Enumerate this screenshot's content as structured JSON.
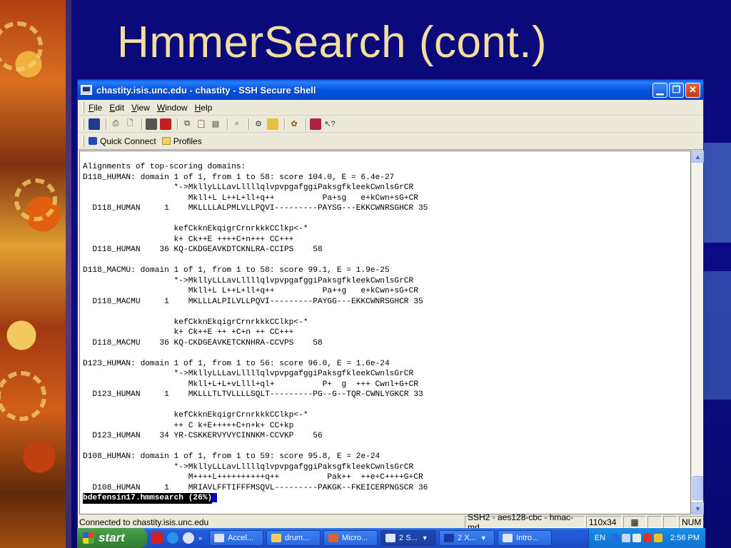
{
  "slide": {
    "title": "HmmerSearch (cont.)"
  },
  "window": {
    "title": "chastity.isis.unc.edu - chastity - SSH Secure Shell",
    "menu": [
      {
        "pre": "",
        "u": "F",
        "post": "ile"
      },
      {
        "pre": "",
        "u": "E",
        "post": "dit"
      },
      {
        "pre": "",
        "u": "V",
        "post": "iew"
      },
      {
        "pre": "",
        "u": "W",
        "post": "indow"
      },
      {
        "pre": "",
        "u": "H",
        "post": "elp"
      }
    ],
    "toolbar_icons": [
      "save-icon",
      "print-icon",
      "print-preview-icon",
      "new-terminal-icon",
      "new-file-transfer-icon",
      "copy-icon",
      "paste-icon",
      "paste-alt-icon",
      "find-icon",
      "settings-icon",
      "profiles-icon",
      "help-book-icon",
      "whats-this-icon"
    ],
    "quick_connect": "Quick Connect",
    "profiles": "Profiles",
    "terminal_lines": [
      "Alignments of top-scoring domains:",
      "D118_HUMAN: domain 1 of 1, from 1 to 58: score 104.0, E = 6.4e-27",
      "                   *->MkllyLLLavLllllqlvpvpgafggiPaksgfkleekCwnlsGrCR",
      "                      Mkll+L L++L+ll+q++          Pa+sg   e+kCwn+sG+CR",
      "  D118_HUMAN     1    MKLLLLALPMLVLLPQVI---------PAYSG---EKKCWNRSGHCR 35",
      "",
      "                   kefCkknEkqigrCrnrkkkCClkp<-*",
      "                   k+ Ck++E ++++C+n+++ CC+++",
      "  D118_HUMAN    36 KQ-CKDGEAVKDTCKNLRA-CCIPS    58",
      "",
      "D118_MACMU: domain 1 of 1, from 1 to 58: score 99.1, E = 1.9e-25",
      "                   *->MkllyLLLavLllllqlvpvpgafggiPaksgfkleekCwnlsGrCR",
      "                      Mkll+L L++L+ll+q++          Pa++g   e+kCwn+sG+CR",
      "  D118_MACMU     1    MKLLLALPILVLLPQVI---------PAYGG---EKKCWNRSGHCR 35",
      "",
      "                   kefCkknEkqigrCrnrkkkCClkp<-*",
      "                   k+ Ck++E ++ +C+n ++ CC+++",
      "  D118_MACMU    36 KQ-CKDGEAVKETCKNHRA-CCVPS    58",
      "",
      "D123_HUMAN: domain 1 of 1, from 1 to 56: score 96.0, E = 1.6e-24",
      "                   *->MkllyLLLavLllllqlvpvpgafggiPaksgfkleekCwnlsGrCR",
      "                      Mkll+L+L+vLlll+ql+          P+  g  +++ Cwnl+G+CR",
      "  D123_HUMAN     1    MKLLLTLTVLLLLSQLT---------PG--G--TQR-CWNLYGKCR 33",
      "",
      "                   kefCkknEkqigrCrnrkkkCClkp<-*",
      "                   ++ C k+E+++++C+n+k+ CC+kp",
      "  D123_HUMAN    34 YR-CSKKERVYVYCINNKM-CCVKP    56",
      "",
      "D108_HUMAN: domain 1 of 1, from 1 to 59: score 95.8, E = 2e-24",
      "                   *->MkllyLLLavLllllqlvpvpgafggiPaksgfkleekCwnlsGrCR",
      "                      M++++L++++++++++q++          Pak++  ++e+C++++G+CR",
      "  D108_HUMAN     1    MRIAVLFFTIFFFMSQVL---------PAKGK--FKEICERPNGSCR 36"
    ],
    "pager_status": "bdefensin17.hmmsearch (26%)",
    "status": {
      "connection": "Connected to chastity.isis.unc.edu",
      "cipher": "SSH2 - aes128-cbc - hmac-md",
      "size": "110x34",
      "num": "NUM"
    }
  },
  "taskbar": {
    "start": "start",
    "tasks": [
      "Accel...",
      "drum...",
      "Micro...",
      "2 S...",
      "2 X...",
      "Intro..."
    ],
    "lang": "EN",
    "time": "2:56 PM"
  },
  "colors": {
    "slide_bg": "#0a0a7c",
    "title_color": "#f3dea0",
    "xp_blue": "#0054e3",
    "start_green": "#3a8d3a"
  }
}
